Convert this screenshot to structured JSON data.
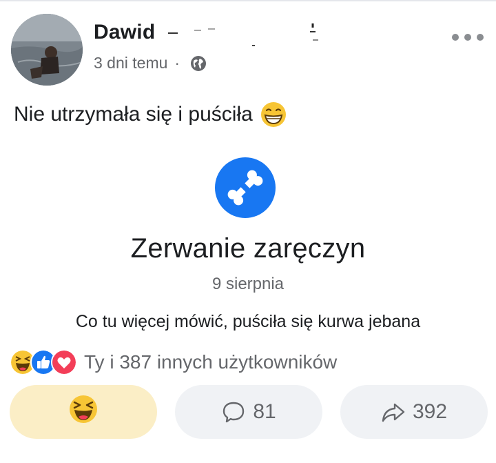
{
  "post": {
    "author_name": "Dawid",
    "timestamp": "3 dni temu",
    "separator": "·",
    "privacy_icon": "globe-icon",
    "more_icon": "more-options-icon",
    "text": "Nie utrzymała się i puściła",
    "text_emoji": "grinning-face-emoji"
  },
  "life_event": {
    "icon": "broken-bone-icon",
    "title": "Zerwanie zaręczyn",
    "date": "9 sierpnia",
    "description": "Co tu więcej mówić, puściła się kurwa jebana"
  },
  "reactions": {
    "icons": [
      "haha-icon",
      "like-icon",
      "love-icon"
    ],
    "summary": "Ty i 387 innych użytkowników"
  },
  "actions": {
    "react_icon": "haha-icon",
    "comments_count": "81",
    "shares_count": "392"
  },
  "colors": {
    "accent_blue": "#1877f2",
    "muted_text": "#65676b",
    "reacted_button_bg": "#fbeec6",
    "button_bg": "#f0f2f5",
    "haha_yellow": "#f7c535",
    "love_red": "#f33e58"
  }
}
